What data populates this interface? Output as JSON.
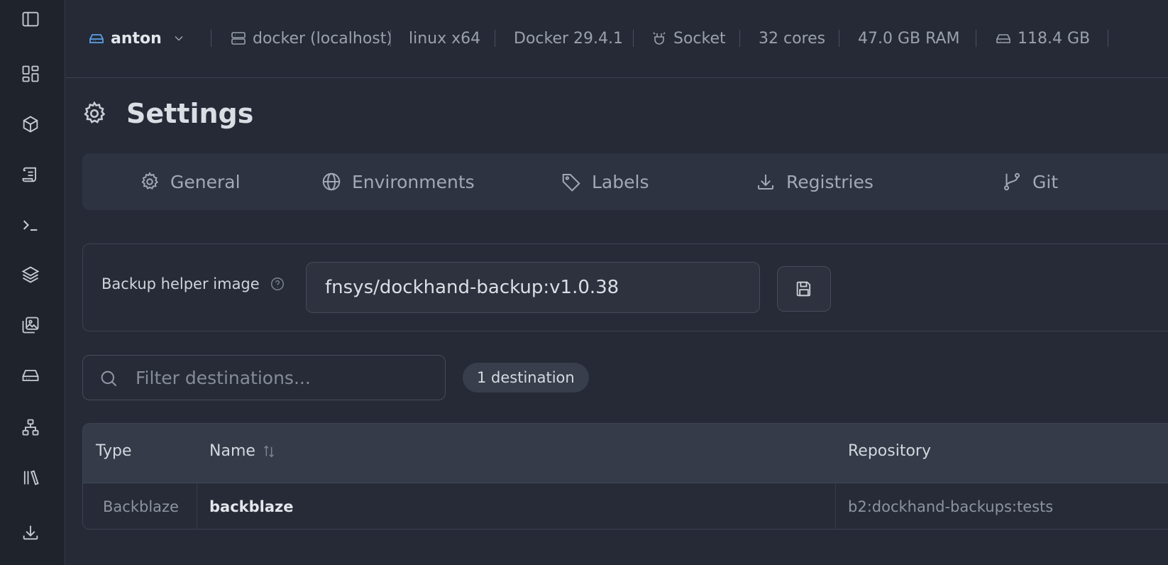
{
  "sidebar": {
    "items": [
      {
        "icon": "sidebar-toggle-icon"
      },
      {
        "icon": "dashboard-icon"
      },
      {
        "icon": "container-icon"
      },
      {
        "icon": "stacks-icon"
      },
      {
        "icon": "terminal-icon"
      },
      {
        "icon": "layers-icon"
      },
      {
        "icon": "images-icon"
      },
      {
        "icon": "storage-icon"
      },
      {
        "icon": "network-icon"
      },
      {
        "icon": "library-icon"
      },
      {
        "icon": "download-icon"
      }
    ]
  },
  "topbar": {
    "environment": "anton",
    "host": "docker (localhost)",
    "platform": "linux x64",
    "docker_version": "Docker 29.4.1",
    "connection": "Socket",
    "cores": "32 cores",
    "ram": "47.0 GB RAM",
    "disk": "118.4 GB"
  },
  "page": {
    "title": "Settings"
  },
  "tabs": [
    {
      "label": "General",
      "icon": "gear-icon"
    },
    {
      "label": "Environments",
      "icon": "globe-icon"
    },
    {
      "label": "Labels",
      "icon": "tag-icon"
    },
    {
      "label": "Registries",
      "icon": "download-icon"
    },
    {
      "label": "Git",
      "icon": "git-branch-icon"
    }
  ],
  "backup": {
    "label": "Backup helper image",
    "value": "fnsys/dockhand-backup:v1.0.38"
  },
  "filter": {
    "placeholder": "Filter destinations...",
    "count": "1 destination"
  },
  "table": {
    "headers": {
      "type": "Type",
      "name": "Name",
      "repository": "Repository"
    },
    "rows": [
      {
        "type": "Backblaze",
        "name": "backblaze",
        "repository": "b2:dockhand-backups:tests"
      }
    ]
  },
  "colors": {
    "background": "#252a36",
    "sidebar": "#1f232c",
    "accent": "#4f8fd8"
  }
}
